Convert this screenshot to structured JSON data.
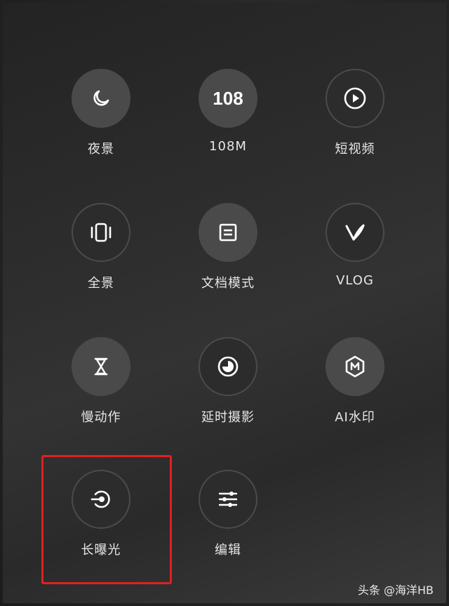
{
  "modes": [
    {
      "id": "night",
      "label": "夜景",
      "icon": "moon-icon"
    },
    {
      "id": "108m",
      "label": "108M",
      "icon_text": "108"
    },
    {
      "id": "short-video",
      "label": "短视频",
      "icon": "play-icon"
    },
    {
      "id": "panorama",
      "label": "全景",
      "icon": "panorama-icon"
    },
    {
      "id": "document",
      "label": "文档模式",
      "icon": "document-icon"
    },
    {
      "id": "vlog",
      "label": "VLOG",
      "icon": "vlog-icon"
    },
    {
      "id": "slow-motion",
      "label": "慢动作",
      "icon": "hourglass-icon"
    },
    {
      "id": "timelapse",
      "label": "延时摄影",
      "icon": "timelapse-icon"
    },
    {
      "id": "ai-watermark",
      "label": "AI水印",
      "icon": "watermark-icon"
    },
    {
      "id": "long-exposure",
      "label": "长曝光",
      "icon": "long-exposure-icon"
    },
    {
      "id": "edit",
      "label": "编辑",
      "icon": "sliders-icon"
    }
  ],
  "watermark": {
    "text": "头条 @海洋HB"
  },
  "colors": {
    "highlight": "#e02020"
  }
}
